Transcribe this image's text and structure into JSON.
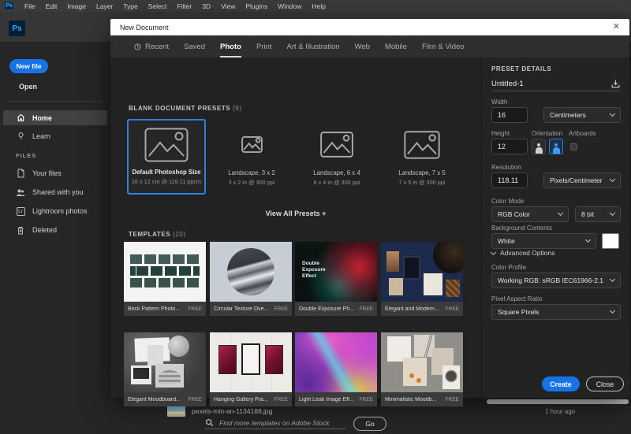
{
  "menubar": {
    "app_icon": "Ps",
    "items": [
      "File",
      "Edit",
      "Image",
      "Layer",
      "Type",
      "Select",
      "Filter",
      "3D",
      "View",
      "Plugins",
      "Window",
      "Help"
    ]
  },
  "appbar": {
    "logo": "Ps"
  },
  "sidebar": {
    "new_file_label": "New file",
    "open_label": "Open",
    "nav": [
      {
        "label": "Home"
      },
      {
        "label": "Learn"
      }
    ],
    "files_header": "FILES",
    "files": [
      {
        "label": "Your files"
      },
      {
        "label": "Shared with you"
      },
      {
        "label": "Lightroom photos",
        "icon_text": "Lr"
      },
      {
        "label": "Deleted"
      }
    ]
  },
  "dialog": {
    "title": "New Document",
    "close_glyph": "✕",
    "tabs": [
      "Recent",
      "Saved",
      "Photo",
      "Print",
      "Art & Illustration",
      "Web",
      "Mobile",
      "Film & Video"
    ],
    "active_tab": "Photo",
    "presets_header": "BLANK DOCUMENT PRESETS",
    "presets_count": "(9)",
    "presets": [
      {
        "title": "Default Photoshop Size",
        "subtitle": "16 x 12 cm @ 118.11 ppcm",
        "selected": true
      },
      {
        "title": "Landscape, 3 x 2",
        "subtitle": "3 x 2 in @ 300 ppi",
        "selected": false
      },
      {
        "title": "Landscape, 6 x 4",
        "subtitle": "6 x 4 in @ 300 ppi",
        "selected": false
      },
      {
        "title": "Landscape, 7 x 5",
        "subtitle": "7 x 5 in @ 300 ppi",
        "selected": false
      }
    ],
    "view_all_label": "View All Presets +",
    "templates_header": "TEMPLATES",
    "templates_count": "(20)",
    "templates": [
      {
        "label": "Brick Pattern Photo...",
        "badge": "FREE"
      },
      {
        "label": "Circular Texture Ove...",
        "badge": "FREE"
      },
      {
        "label": "Double Exposure Ph...",
        "badge": "FREE",
        "overlay_text": "Double Exposure Effect"
      },
      {
        "label": "Elegant and Modern...",
        "badge": "FREE"
      },
      {
        "label": "Elegant Moodboard...",
        "badge": "FREE"
      },
      {
        "label": "Hanging Gallery Fra...",
        "badge": "FREE"
      },
      {
        "label": "Light Leak Image Eff...",
        "badge": "FREE"
      },
      {
        "label": "Minimalistic Moodb...",
        "badge": "FREE"
      }
    ],
    "search": {
      "placeholder": "Find more templates on Adobe Stock",
      "go_label": "Go"
    },
    "panel": {
      "header": "PRESET DETAILS",
      "doc_name": "Untitled-1",
      "width_label": "Width",
      "width_value": "16",
      "unit_value": "Centimeters",
      "height_label": "Height",
      "height_value": "12",
      "orientation_label": "Orientation",
      "artboards_label": "Artboards",
      "resolution_label": "Resolution",
      "resolution_value": "118.11",
      "resolution_unit": "Pixels/Centimeter",
      "color_mode_label": "Color Mode",
      "color_mode_value": "RGB Color",
      "bit_depth_value": "8 bit",
      "background_label": "Background Contents",
      "background_value": "White",
      "advanced_label": "Advanced Options",
      "color_profile_label": "Color Profile",
      "color_profile_value": "Working RGB: sRGB IEC61966-2.1",
      "pixel_aspect_label": "Pixel Aspect Ratio",
      "pixel_aspect_value": "Square Pixels",
      "create_label": "Create",
      "close_label": "Close"
    }
  },
  "recent_files": {
    "file_name": "pexels-min-an-1134188.jpg",
    "file_time": "1 hour ago"
  },
  "colors": {
    "accent": "#1473e6",
    "selection": "#2d7fe0",
    "ps_logo": "#31a8ff"
  }
}
